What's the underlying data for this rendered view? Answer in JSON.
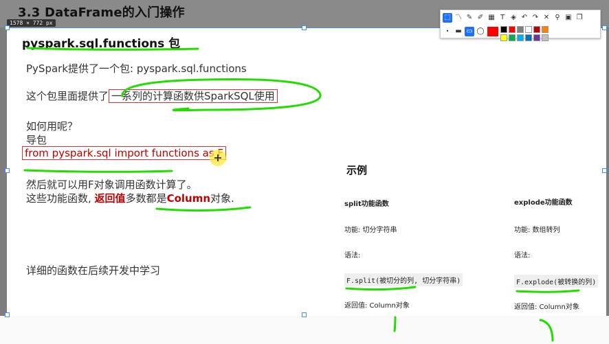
{
  "header": {
    "title": "3.3 DataFrame的入门操作",
    "dimension_badge": "1578 × 772  px"
  },
  "slide": {
    "heading": "pyspark.sql.functions 包",
    "line1": "PySpark提供了一个包: pyspark.sql.functions",
    "line2_prefix": "这个包里面提供了",
    "line2_boxed": "一系列的计算函数供SparkSQL使用",
    "line3": "如何用呢？",
    "line4": "导包",
    "import_code": "from pyspark.sql import functions as F",
    "line5": "然后就可以用F对象调用函数计算了。",
    "line6_a": "这些功能函数, ",
    "line6_b": "返回值",
    "line6_c": "多数都是",
    "line6_d": "Column",
    "line6_e": "对象.",
    "line7": "详细的函数在后续开发中学习"
  },
  "example": {
    "title": "示例",
    "split": {
      "name": "split功能函数",
      "desc": "功能: 切分字符串",
      "syntax_label": "语法:",
      "syntax": "F.split(被切分的列, 切分字符串)",
      "returns": "返回值: Column对象"
    },
    "explode": {
      "name": "explode功能函数",
      "desc": "功能: 数组转列",
      "syntax_label": "语法:",
      "syntax": "F.explode(被转换的列)",
      "returns": "返回值: Column对象"
    }
  },
  "toolbar": {
    "tools": [
      "select-icon",
      "line-chart-icon",
      "pen-icon",
      "highlighter-icon",
      "mosaic-icon",
      "text-icon",
      "eraser-icon",
      "undo-icon",
      "redo-icon",
      "close-icon",
      "pin-icon",
      "save-icon",
      "copy-icon"
    ],
    "colors": [
      "#000000",
      "#ff0000",
      "#7f7f7f",
      "#ffffff",
      "#c00000",
      "#ff7f00",
      "#ffff00",
      "#00b050",
      "#00b0f0",
      "#0070c0",
      "#7030a0",
      "#c0c0c0"
    ],
    "active_color": "#ff0000",
    "annotation_color": "#22dd00"
  }
}
